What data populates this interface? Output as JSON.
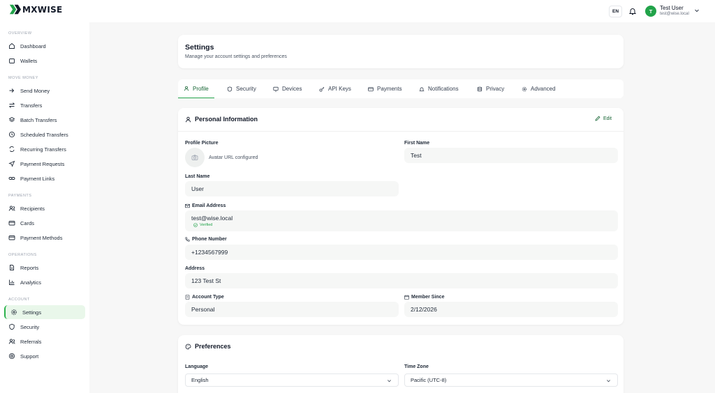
{
  "brand": {
    "name": "MXWISE",
    "color": "#22a34a"
  },
  "header": {
    "lang": "EN",
    "user": {
      "initial": "T",
      "name": "Test User",
      "email": "test@wise.local"
    }
  },
  "sidebar": {
    "sections": [
      {
        "title": "OVERVIEW",
        "items": [
          {
            "label": "Dashboard",
            "icon": "home-icon"
          },
          {
            "label": "Wallets",
            "icon": "wallet-icon"
          }
        ]
      },
      {
        "title": "MOVE MONEY",
        "items": [
          {
            "label": "Send Money",
            "icon": "send-icon"
          },
          {
            "label": "Transfers",
            "icon": "swap-icon"
          },
          {
            "label": "Batch Transfers",
            "icon": "layers-icon"
          },
          {
            "label": "Scheduled Transfers",
            "icon": "clock-icon"
          },
          {
            "label": "Recurring Transfers",
            "icon": "repeat-icon"
          },
          {
            "label": "Payment Requests",
            "icon": "paper-plane-icon"
          },
          {
            "label": "Payment Links",
            "icon": "link-icon"
          }
        ]
      },
      {
        "title": "PAYMENTS",
        "items": [
          {
            "label": "Recipients",
            "icon": "users-icon"
          },
          {
            "label": "Cards",
            "icon": "card-icon"
          },
          {
            "label": "Payment Methods",
            "icon": "card-icon"
          }
        ]
      },
      {
        "title": "OPERATIONS",
        "items": [
          {
            "label": "Reports",
            "icon": "file-icon"
          },
          {
            "label": "Analytics",
            "icon": "bar-chart-icon"
          }
        ]
      },
      {
        "title": "ACCOUNT",
        "items": [
          {
            "label": "Settings",
            "icon": "gear-icon",
            "active": true
          },
          {
            "label": "Security",
            "icon": "shield-icon"
          },
          {
            "label": "Referrals",
            "icon": "users-icon"
          },
          {
            "label": "Support",
            "icon": "lifebuoy-icon"
          }
        ]
      }
    ]
  },
  "page": {
    "title": "Settings",
    "subtitle": "Manage your account settings and preferences"
  },
  "tabs": [
    {
      "label": "Profile",
      "icon": "user-icon",
      "active": true
    },
    {
      "label": "Security",
      "icon": "shield-icon"
    },
    {
      "label": "Devices",
      "icon": "monitor-icon"
    },
    {
      "label": "API Keys",
      "icon": "key-icon"
    },
    {
      "label": "Payments",
      "icon": "card-icon"
    },
    {
      "label": "Notifications",
      "icon": "bell-icon"
    },
    {
      "label": "Privacy",
      "icon": "database-icon"
    },
    {
      "label": "Advanced",
      "icon": "gear-icon"
    }
  ],
  "personal": {
    "title": "Personal Information",
    "edit_label": "Edit",
    "profile_picture_label": "Profile Picture",
    "avatar_status": "Avatar URL configured",
    "first_name_label": "First Name",
    "first_name": "Test",
    "last_name_label": "Last Name",
    "last_name": "User",
    "email_label": "Email Address",
    "email": "test@wise.local",
    "email_verified": "Verified",
    "phone_label": "Phone Number",
    "phone": "+1234567999",
    "address_label": "Address",
    "address": "123 Test St",
    "account_type_label": "Account Type",
    "account_type": "Personal",
    "member_since_label": "Member Since",
    "member_since": "2/12/2026"
  },
  "preferences": {
    "title": "Preferences",
    "language_label": "Language",
    "language": "English",
    "timezone_label": "Time Zone",
    "timezone": "Pacific (UTC-8)"
  }
}
